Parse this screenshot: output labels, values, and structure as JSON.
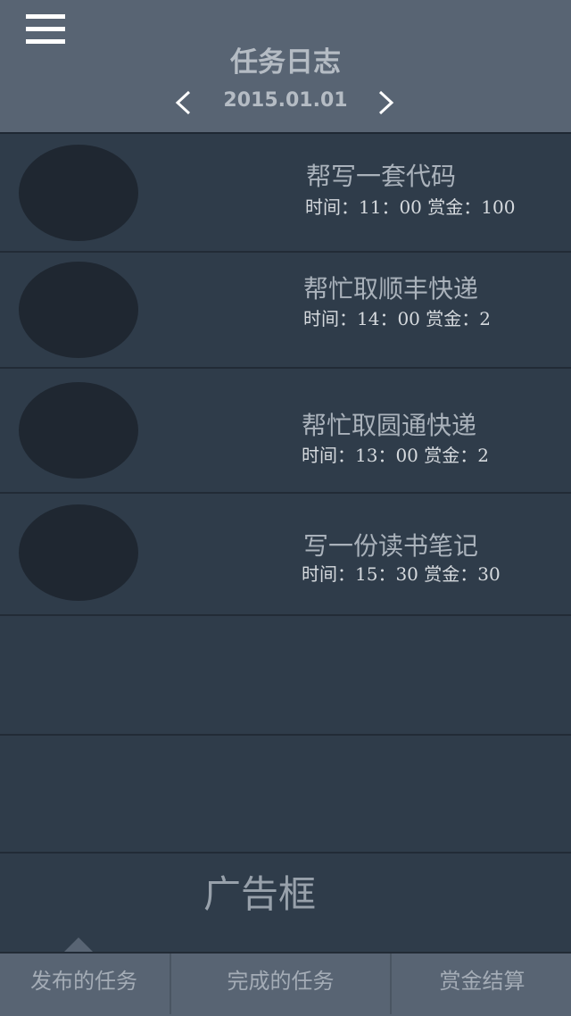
{
  "header": {
    "title": "任务日志",
    "date": "2015.01.01"
  },
  "tasks": [
    {
      "name": "帮写一套代码",
      "meta": "时间：11：00 赏金：100"
    },
    {
      "name": "帮忙取顺丰快递",
      "meta": "时间：14：00 赏金：2"
    },
    {
      "name": "帮忙取圆通快递",
      "meta": "时间：13：00 赏金：2"
    },
    {
      "name": "写一份读书笔记",
      "meta": "时间：15：30 赏金：30"
    }
  ],
  "ad": {
    "label": "广告框"
  },
  "tabs": [
    {
      "label": "发布的任务"
    },
    {
      "label": "完成的任务"
    },
    {
      "label": "赏金结算"
    }
  ],
  "colors": {
    "header_bg": "#586473",
    "page_bg": "#2f3c4a",
    "avatar_bg": "#1f2731",
    "title_text": "#b5bcc4"
  },
  "icons": {
    "menu": "menu-icon",
    "prev": "chevron-left-icon",
    "next": "chevron-right-icon"
  }
}
